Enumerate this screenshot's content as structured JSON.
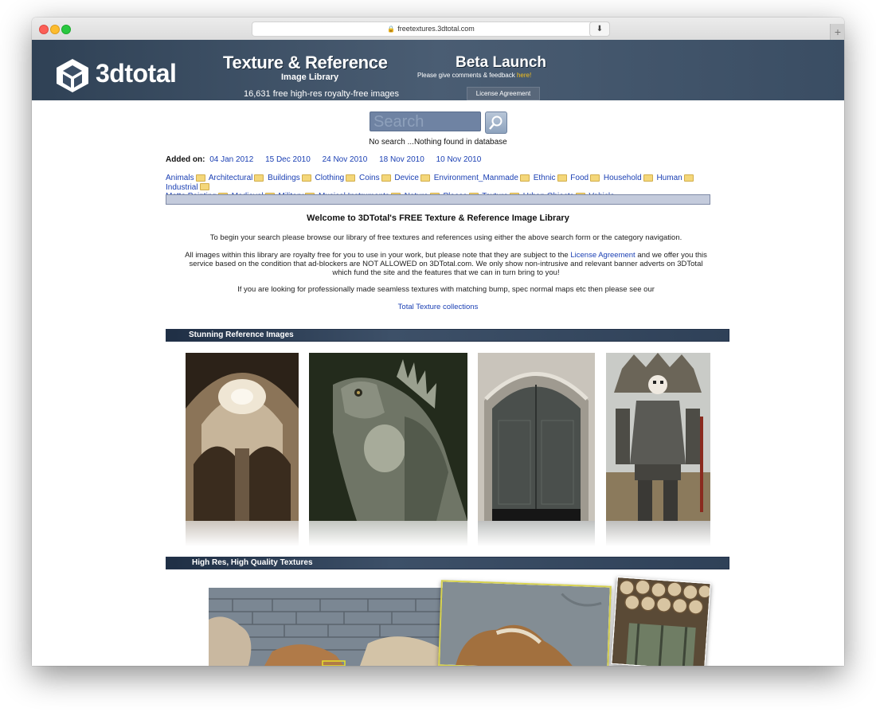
{
  "browser": {
    "url": "freetextures.3dtotal.com"
  },
  "banner": {
    "logo": "3dtotal",
    "title": "Texture & Reference",
    "subtitle": "Image Library",
    "count": "16,631 free high-res royalty-free images",
    "beta": "Beta Launch",
    "feedback_prefix": "Please give comments & feedback ",
    "feedback_link": "here!",
    "license_btn": "License Agreement"
  },
  "search": {
    "placeholder": "Search",
    "status": "No search ...Nothing found in database"
  },
  "added": {
    "label": "Added on:",
    "dates": [
      "04 Jan 2012",
      "15 Dec 2010",
      "24 Nov 2010",
      "18 Nov 2010",
      "10 Nov 2010"
    ]
  },
  "categories": [
    "Animals",
    "Architectural",
    "Buildings",
    "Clothing",
    "Coins",
    "Device",
    "Environment_Manmade",
    "Ethnic",
    "Food",
    "Household",
    "Human",
    "Industrial",
    "Matte Painting",
    "Medieval",
    "Military",
    "Musical Instruments",
    "Nature",
    "Places",
    "Texture",
    "Urban Objects",
    "Vehicle"
  ],
  "welcome": {
    "title": "Welcome to 3DTotal's FREE Texture & Reference Image Library",
    "p1": "To begin your search please browse our library of free textures and references using either the above search form or the category navigation.",
    "p2a": "All images within this library are royalty free for you to use in your work, but please note that they are subject to the ",
    "p2link": "License Agreement",
    "p2b": " and we offer you this service based on the condition that ad-blockers are NOT ALLOWED on 3DTotal.com. We only show non-intrusive and relevant banner adverts on 3DTotal which fund the site and the features that we can in turn bring to you!",
    "p3": "If you are looking for professionally made seamless textures with matching bump, spec normal maps etc then please see our",
    "link": "Total Texture collections"
  },
  "sections": {
    "reference": "Stunning Reference Images",
    "textures": "High Res, High Quality Textures"
  }
}
